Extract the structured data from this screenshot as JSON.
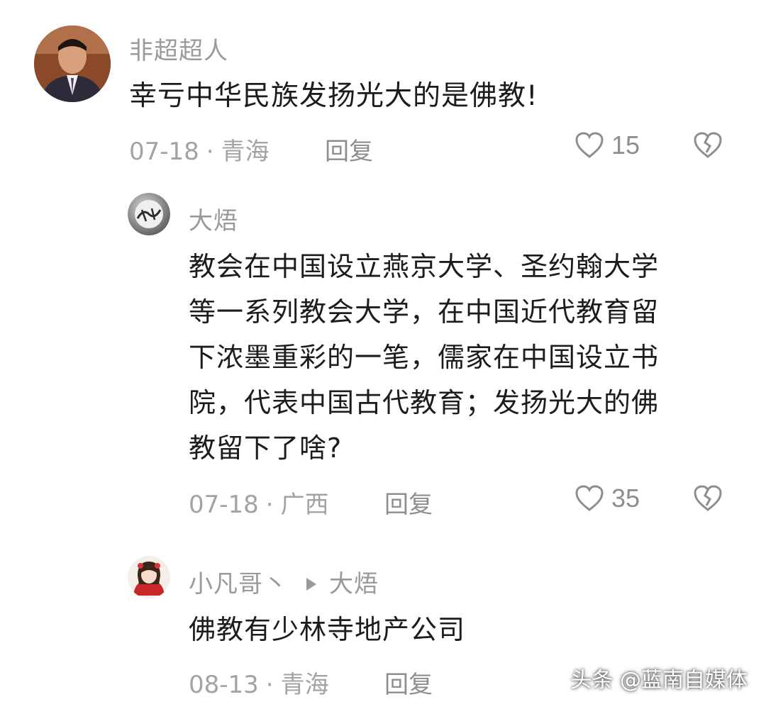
{
  "comments": [
    {
      "username": "非超超人",
      "text": "幸亏中华民族发扬光大的是佛教!",
      "date": "07-18",
      "separator": "·",
      "location": "青海",
      "reply_label": "回复",
      "likes": "15",
      "avatar_icon": "man-in-suit-photo"
    },
    {
      "username": "大焐",
      "text_lines": [
        "教会在中国设立燕京大学、圣约翰大学",
        "等一系列教会大学，在中国近代教育留",
        "下浓墨重彩的一笔，儒家在中国设立书",
        "院，代表中国古代教育；发扬光大的佛",
        "教留下了啥?"
      ],
      "date": "07-18",
      "separator": "·",
      "location": "广西",
      "reply_label": "回复",
      "likes": "35",
      "avatar_icon": "calligraphy-logo"
    },
    {
      "username": "小凡哥丶",
      "reply_to": "大焐",
      "text": "佛教有少林寺地产公司",
      "date": "08-13",
      "separator": "·",
      "location": "青海",
      "reply_label": "回复",
      "avatar_icon": "anime-girl-red"
    }
  ],
  "watermark": "头条 @蓝南自媒体",
  "icons": {
    "like": "heart-outline-icon",
    "dislike": "broken-heart-icon"
  },
  "colors": {
    "meta_gray": "#a3a3a3",
    "text_dark": "#1c1c1c"
  }
}
